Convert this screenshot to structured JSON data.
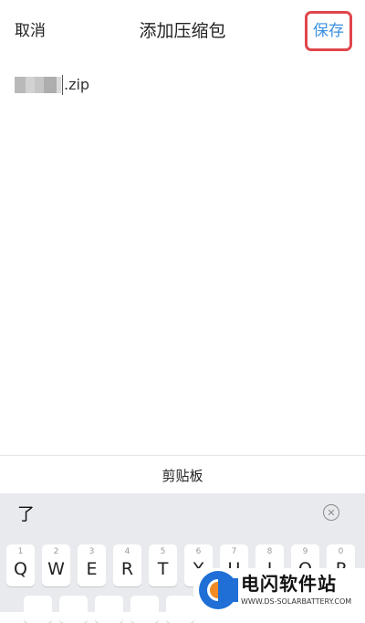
{
  "header": {
    "cancel_label": "取消",
    "title": "添加压缩包",
    "save_label": "保存"
  },
  "editor": {
    "filename_extension": ".zip"
  },
  "clipboard": {
    "label": "剪贴板"
  },
  "keyboard": {
    "candidate": "了",
    "row1": [
      {
        "num": "1",
        "letter": "Q"
      },
      {
        "num": "2",
        "letter": "W"
      },
      {
        "num": "3",
        "letter": "E"
      },
      {
        "num": "4",
        "letter": "R"
      },
      {
        "num": "5",
        "letter": "T"
      },
      {
        "num": "6",
        "letter": "Y"
      },
      {
        "num": "7",
        "letter": "U"
      },
      {
        "num": "8",
        "letter": "I"
      },
      {
        "num": "9",
        "letter": "O"
      },
      {
        "num": "0",
        "letter": "P"
      }
    ]
  },
  "watermark": {
    "title": "电闪软件站",
    "url": "WWW.DS-SOLARBATTERY.COM"
  },
  "colors": {
    "accent": "#3b8fe0",
    "highlight_border": "#e0464b",
    "keyboard_bg": "#e9eaed"
  }
}
